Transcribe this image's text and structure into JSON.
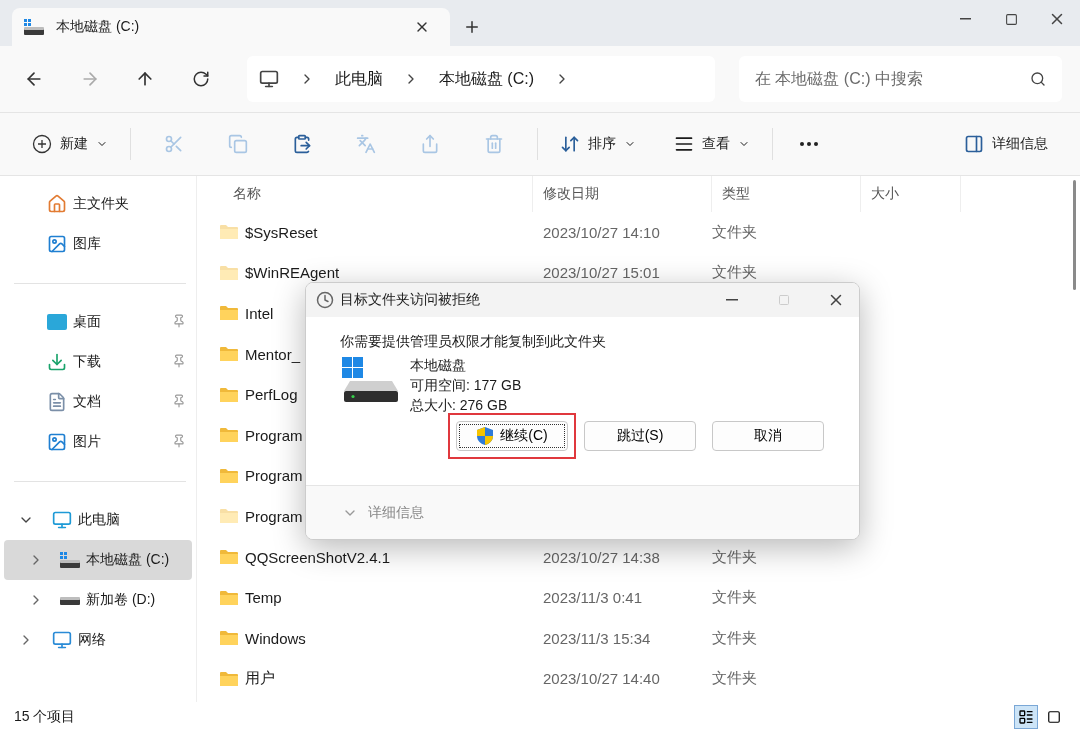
{
  "tab": {
    "title": "本地磁盘 (C:)"
  },
  "address": {
    "path": [
      "此电脑",
      "本地磁盘 (C:)"
    ]
  },
  "search": {
    "placeholder": "在 本地磁盘 (C:) 中搜索"
  },
  "toolbar": {
    "new": "新建",
    "sort": "排序",
    "view": "查看",
    "details": "详细信息",
    "actions": [
      {
        "kind": "cut",
        "disabled": true
      },
      {
        "kind": "copy",
        "disabled": true
      },
      {
        "kind": "paste",
        "disabled": false
      },
      {
        "kind": "rename",
        "disabled": true
      },
      {
        "kind": "share",
        "disabled": true
      },
      {
        "kind": "delete",
        "disabled": true
      }
    ]
  },
  "sidebar": {
    "groups": [
      {
        "items": [
          {
            "label": "主文件夹",
            "kind": "home",
            "pinned": false
          },
          {
            "label": "图库",
            "kind": "gallery",
            "pinned": false
          }
        ]
      },
      {
        "items": [
          {
            "label": "桌面",
            "kind": "desktop",
            "pinned": true
          },
          {
            "label": "下载",
            "kind": "download",
            "pinned": true
          },
          {
            "label": "文档",
            "kind": "document",
            "pinned": true
          },
          {
            "label": "图片",
            "kind": "picture",
            "pinned": true
          }
        ]
      }
    ],
    "tree": [
      {
        "label": "此电脑",
        "kind": "pc",
        "expanded": true,
        "selected": false,
        "children": [
          {
            "label": "本地磁盘 (C:)",
            "kind": "system-drive",
            "expanded": false,
            "selected": true
          },
          {
            "label": "新加卷 (D:)",
            "kind": "drive",
            "expanded": false,
            "selected": false
          }
        ]
      },
      {
        "label": "网络",
        "kind": "network",
        "expanded": false,
        "selected": false
      }
    ]
  },
  "columns": [
    "名称",
    "修改日期",
    "类型",
    "大小"
  ],
  "rows": [
    {
      "name": "$SysReset",
      "modified": "2023/10/27 14:10",
      "type": "文件夹",
      "hidden": true
    },
    {
      "name": "$WinREAgent",
      "modified": "2023/10/27 15:01",
      "type": "文件夹",
      "hidden": true
    },
    {
      "name": "Intel",
      "hidden": false
    },
    {
      "name": "Mentor_",
      "hidden": false
    },
    {
      "name": "PerfLog",
      "hidden": false
    },
    {
      "name": "Program",
      "hidden": false
    },
    {
      "name": "Program",
      "hidden": false
    },
    {
      "name": "Program",
      "hidden": true
    },
    {
      "name": "QQScreenShotV2.4.1",
      "modified": "2023/10/27 14:38",
      "type": "文件夹",
      "hidden": false
    },
    {
      "name": "Temp",
      "modified": "2023/11/3 0:41",
      "type": "文件夹",
      "hidden": false
    },
    {
      "name": "Windows",
      "modified": "2023/11/3 15:34",
      "type": "文件夹",
      "hidden": false
    },
    {
      "name": "用户",
      "modified": "2023/10/27 14:40",
      "type": "文件夹",
      "hidden": false
    }
  ],
  "status": "15 个项目",
  "views": [
    {
      "kind": "details",
      "selected": true
    },
    {
      "kind": "tiles",
      "selected": false
    }
  ],
  "dialog": {
    "title": "目标文件夹访问被拒绝",
    "message": "你需要提供管理员权限才能复制到此文件夹",
    "drive_name": "本地磁盘",
    "free": "可用空间: 177 GB",
    "total": "总大小: 276 GB",
    "buttons": [
      {
        "label": "继续(C)",
        "kind": "admin",
        "highlighted": true
      },
      {
        "label": "跳过(S)",
        "kind": "plain",
        "highlighted": false
      },
      {
        "label": "取消",
        "kind": "plain",
        "highlighted": false
      }
    ],
    "details": "详细信息"
  }
}
